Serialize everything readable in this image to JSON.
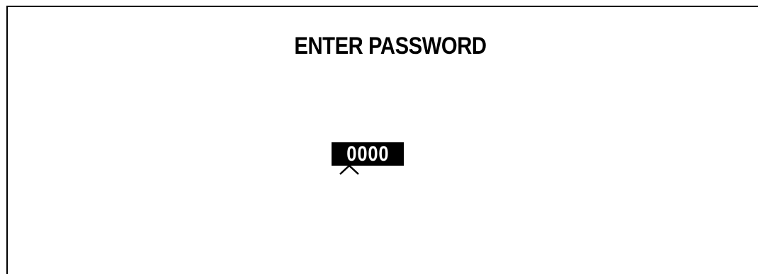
{
  "screen": {
    "title": "ENTER PASSWORD"
  },
  "password": {
    "value": "0000",
    "cursor_position": 1
  },
  "icons": {
    "caret": "caret-up-icon"
  }
}
